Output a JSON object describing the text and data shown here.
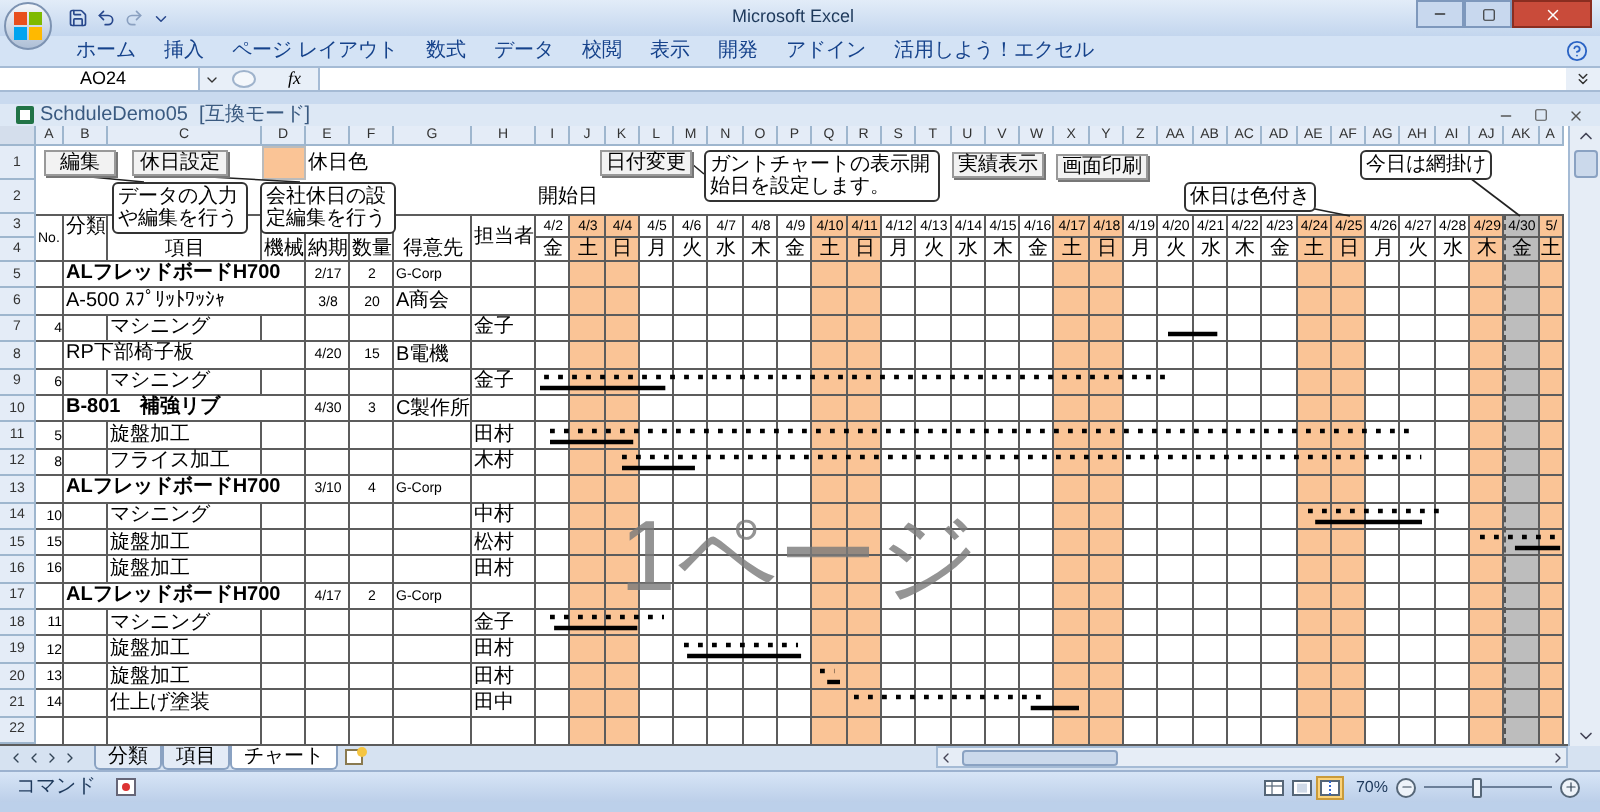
{
  "window": {
    "title": "Microsoft Excel"
  },
  "ribbon_tabs": [
    "ホーム",
    "挿入",
    "ページ レイアウト",
    "数式",
    "データ",
    "校閲",
    "表示",
    "開発",
    "アドイン",
    "活用しよう！エクセル"
  ],
  "formula_bar": {
    "name_box": "AO24",
    "function_symbol": "fx"
  },
  "workbook": {
    "title": "SchduleDemo05  [互換モード]"
  },
  "column_headers": [
    "A",
    "B",
    "C",
    "D",
    "E",
    "F",
    "G",
    "H",
    "I",
    "J",
    "K",
    "L",
    "M",
    "N",
    "O",
    "P",
    "Q",
    "R",
    "S",
    "T",
    "U",
    "V",
    "W",
    "X",
    "Y",
    "Z",
    "AA",
    "AB",
    "AC",
    "AD",
    "AE",
    "AF",
    "AG",
    "AH",
    "AI",
    "AJ",
    "AK",
    "A"
  ],
  "sheet": {
    "header_row_numbers": [
      "1",
      "2",
      "3",
      "4"
    ],
    "buttons": [
      {
        "label": "編集"
      },
      {
        "label": "休日設定"
      },
      {
        "label": "日付変更"
      },
      {
        "label": "実績表示"
      },
      {
        "label": "画面印刷"
      }
    ],
    "holiday_color_label": "休日色",
    "start_date_label": "開始日",
    "callouts": [
      "データの入力や編集を行う",
      "会社休日の設定編集を行う",
      "ガントチャートの表示開始日を設定します。",
      "休日は色付き",
      "今日は網掛け"
    ],
    "header": {
      "no": "No.",
      "category": "分類",
      "item": "項目",
      "machine": "機械",
      "due": "納期",
      "quantity": "数量",
      "customer": "得意先",
      "assignee": "担当者"
    },
    "days": [
      {
        "date": "4/2",
        "weekday": "金",
        "kind": "workday"
      },
      {
        "date": "4/3",
        "weekday": "土",
        "kind": "holiday"
      },
      {
        "date": "4/4",
        "weekday": "日",
        "kind": "holiday"
      },
      {
        "date": "4/5",
        "weekday": "月",
        "kind": "workday"
      },
      {
        "date": "4/6",
        "weekday": "火",
        "kind": "workday"
      },
      {
        "date": "4/7",
        "weekday": "水",
        "kind": "workday"
      },
      {
        "date": "4/8",
        "weekday": "木",
        "kind": "workday"
      },
      {
        "date": "4/9",
        "weekday": "金",
        "kind": "workday"
      },
      {
        "date": "4/10",
        "weekday": "土",
        "kind": "holiday"
      },
      {
        "date": "4/11",
        "weekday": "日",
        "kind": "holiday"
      },
      {
        "date": "4/12",
        "weekday": "月",
        "kind": "workday"
      },
      {
        "date": "4/13",
        "weekday": "火",
        "kind": "workday"
      },
      {
        "date": "4/14",
        "weekday": "水",
        "kind": "workday"
      },
      {
        "date": "4/15",
        "weekday": "木",
        "kind": "workday"
      },
      {
        "date": "4/16",
        "weekday": "金",
        "kind": "workday"
      },
      {
        "date": "4/17",
        "weekday": "土",
        "kind": "holiday"
      },
      {
        "date": "4/18",
        "weekday": "日",
        "kind": "holiday"
      },
      {
        "date": "4/19",
        "weekday": "月",
        "kind": "workday"
      },
      {
        "date": "4/20",
        "weekday": "火",
        "kind": "workday"
      },
      {
        "date": "4/21",
        "weekday": "水",
        "kind": "workday"
      },
      {
        "date": "4/22",
        "weekday": "木",
        "kind": "workday"
      },
      {
        "date": "4/23",
        "weekday": "金",
        "kind": "workday"
      },
      {
        "date": "4/24",
        "weekday": "土",
        "kind": "holiday"
      },
      {
        "date": "4/25",
        "weekday": "日",
        "kind": "holiday"
      },
      {
        "date": "4/26",
        "weekday": "月",
        "kind": "workday"
      },
      {
        "date": "4/27",
        "weekday": "火",
        "kind": "workday"
      },
      {
        "date": "4/28",
        "weekday": "水",
        "kind": "workday"
      },
      {
        "date": "4/29",
        "weekday": "木",
        "kind": "holiday"
      },
      {
        "date": "4/30",
        "weekday": "金",
        "kind": "today"
      },
      {
        "date": "5/",
        "weekday": "土",
        "kind": "holiday"
      }
    ],
    "rows": [
      {
        "number": "5",
        "kind": "product",
        "bold": true,
        "item": "ALフレッドボードH700",
        "due": "2/17",
        "quantity": "2",
        "customer": "G-Corp"
      },
      {
        "number": "6",
        "kind": "product",
        "bold": false,
        "item": "A-500 ｽﾌﾟﾘｯﾄﾜｯｼｬ",
        "due": "3/8",
        "quantity": "20",
        "customer": "A商会"
      },
      {
        "number": "7",
        "kind": "task",
        "no": "4",
        "item": "マシニング",
        "assignee": "金子"
      },
      {
        "number": "8",
        "kind": "product",
        "bold": false,
        "item": "RP下部椅子板",
        "due": "4/20",
        "quantity": "15",
        "customer": "B電機"
      },
      {
        "number": "9",
        "kind": "task",
        "no": "6",
        "item": "マシニング",
        "assignee": "金子"
      },
      {
        "number": "10",
        "kind": "product",
        "bold": true,
        "item": "B-801　補強リブ",
        "due": "4/30",
        "quantity": "3",
        "customer": "C製作所"
      },
      {
        "number": "11",
        "kind": "task",
        "no": "5",
        "item": "旋盤加工",
        "assignee": "田村"
      },
      {
        "number": "12",
        "kind": "task",
        "no": "8",
        "item": "フライス加工",
        "assignee": "木村"
      },
      {
        "number": "13",
        "kind": "product",
        "bold": true,
        "item": "ALフレッドボードH700",
        "due": "3/10",
        "quantity": "4",
        "customer": "G-Corp"
      },
      {
        "number": "14",
        "kind": "task",
        "no": "10",
        "item": "マシニング",
        "assignee": "中村"
      },
      {
        "number": "15",
        "kind": "task",
        "no": "15",
        "item": "旋盤加工",
        "assignee": "松村"
      },
      {
        "number": "16",
        "kind": "task",
        "no": "16",
        "item": "旋盤加工",
        "assignee": "田村"
      },
      {
        "number": "17",
        "kind": "product",
        "bold": true,
        "item": "ALフレッドボードH700",
        "due": "4/17",
        "quantity": "2",
        "customer": "G-Corp"
      },
      {
        "number": "18",
        "kind": "task",
        "no": "11",
        "item": "マシニング",
        "assignee": "金子"
      },
      {
        "number": "19",
        "kind": "task",
        "no": "12",
        "item": "旋盤加工",
        "assignee": "田村"
      },
      {
        "number": "20",
        "kind": "task",
        "no": "13",
        "item": "旋盤加工",
        "assignee": "田村"
      },
      {
        "number": "21",
        "kind": "task",
        "no": "14",
        "item": "仕上げ塗装",
        "assignee": "田中"
      },
      {
        "number": "22",
        "kind": "empty"
      }
    ],
    "page_label": "1ページ"
  },
  "sheet_tabs": [
    {
      "label": "分類",
      "selected": false
    },
    {
      "label": "項目",
      "selected": false
    },
    {
      "label": "チャート",
      "selected": true
    }
  ],
  "status_bar": {
    "mode": "コマンド",
    "view_buttons": [
      {
        "kind": "normal",
        "selected": false
      },
      {
        "kind": "page_layout",
        "selected": false
      },
      {
        "kind": "page_break",
        "selected": true
      }
    ],
    "zoom": "70%",
    "zoom_slider": {
      "level": 0.4
    }
  }
}
